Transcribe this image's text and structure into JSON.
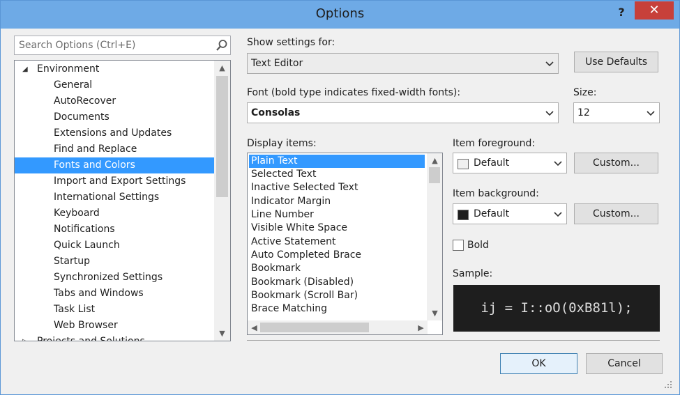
{
  "window": {
    "title": "Options",
    "help": "?",
    "close": "✕"
  },
  "search": {
    "placeholder": "Search Options (Ctrl+E)"
  },
  "tree": {
    "parent": "Environment",
    "children": [
      "General",
      "AutoRecover",
      "Documents",
      "Extensions and Updates",
      "Find and Replace",
      "Fonts and Colors",
      "Import and Export Settings",
      "International Settings",
      "Keyboard",
      "Notifications",
      "Quick Launch",
      "Startup",
      "Synchronized Settings",
      "Tabs and Windows",
      "Task List",
      "Web Browser"
    ],
    "selected": "Fonts and Colors",
    "next_partial": "Projects and Solutions"
  },
  "settings": {
    "show_for_label": "Show settings for:",
    "show_for_value": "Text Editor",
    "use_defaults": "Use Defaults",
    "font_label": "Font (bold type indicates fixed-width fonts):",
    "font_value": "Consolas",
    "size_label": "Size:",
    "size_value": "12",
    "display_items_label": "Display items:",
    "display_items": [
      "Plain Text",
      "Selected Text",
      "Inactive Selected Text",
      "Indicator Margin",
      "Line Number",
      "Visible White Space",
      "Active Statement",
      "Auto Completed Brace",
      "Bookmark",
      "Bookmark (Disabled)",
      "Bookmark (Scroll Bar)",
      "Brace Matching"
    ],
    "fg_label": "Item foreground:",
    "fg_value": "Default",
    "fg_color": "#f0f0f0",
    "bg_label": "Item background:",
    "bg_value": "Default",
    "bg_color": "#1e1e1e",
    "custom": "Custom...",
    "bold_label": "Bold",
    "bold_checked": false,
    "sample_label": "Sample:",
    "sample_text": "ij = I::oO(0xB81l);"
  },
  "buttons": {
    "ok": "OK",
    "cancel": "Cancel"
  }
}
